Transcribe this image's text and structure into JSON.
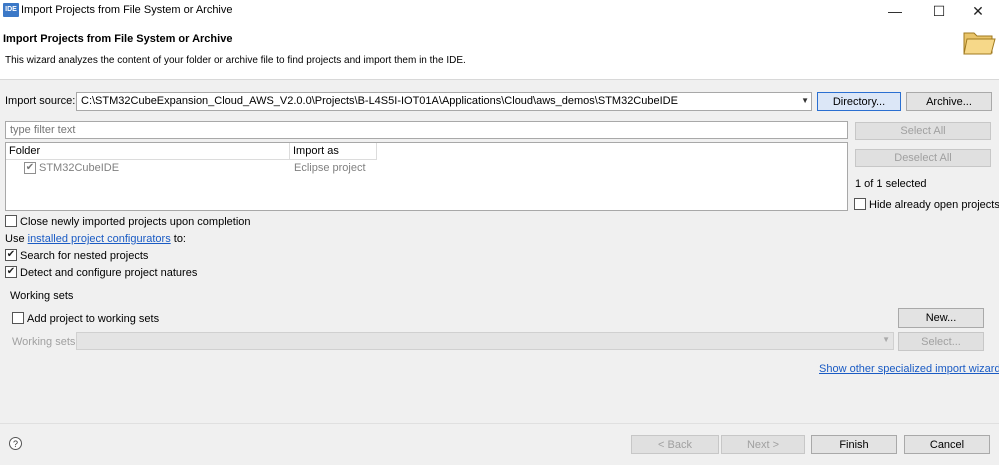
{
  "window": {
    "title": "Import Projects from File System or Archive",
    "icon_text": "IDE",
    "minimize": "—",
    "maximize": "☐",
    "close": "✕"
  },
  "header": {
    "title": "Import Projects from File System or Archive",
    "description": "This wizard analyzes the content of your folder or archive file to find projects and import them in the IDE."
  },
  "import_source": {
    "label": "Import source:",
    "value": "C:\\STM32CubeExpansion_Cloud_AWS_V2.0.0\\Projects\\B-L4S5I-IOT01A\\Applications\\Cloud\\aws_demos\\STM32CubeIDE",
    "directory_button": "Directory...",
    "archive_button": "Archive..."
  },
  "filter": {
    "placeholder": "type filter text"
  },
  "table": {
    "columns": [
      "Folder",
      "Import as"
    ],
    "rows": [
      {
        "folder": "STM32CubeIDE",
        "import_as": "Eclipse project",
        "checked": true
      }
    ]
  },
  "side_actions": {
    "select_all": "Select All",
    "deselect_all": "Deselect All",
    "selected_count": "1 of 1 selected",
    "hide_open": "Hide already open projects"
  },
  "options": {
    "close_on_completion": "Close newly imported projects upon completion",
    "use_prefix": "Use ",
    "configurators_link": "installed project configurators",
    "use_suffix": " to:",
    "search_nested": "Search for nested projects",
    "detect_natures": "Detect and configure project natures"
  },
  "working_sets": {
    "group_label": "Working sets",
    "add_label": "Add project to working sets",
    "new_button": "New...",
    "sets_label": "Working sets:",
    "select_button": "Select..."
  },
  "show_other_link": "Show other specialized import wizards",
  "footer": {
    "help": "?",
    "back": "< Back",
    "next": "Next >",
    "finish": "Finish",
    "cancel": "Cancel"
  }
}
